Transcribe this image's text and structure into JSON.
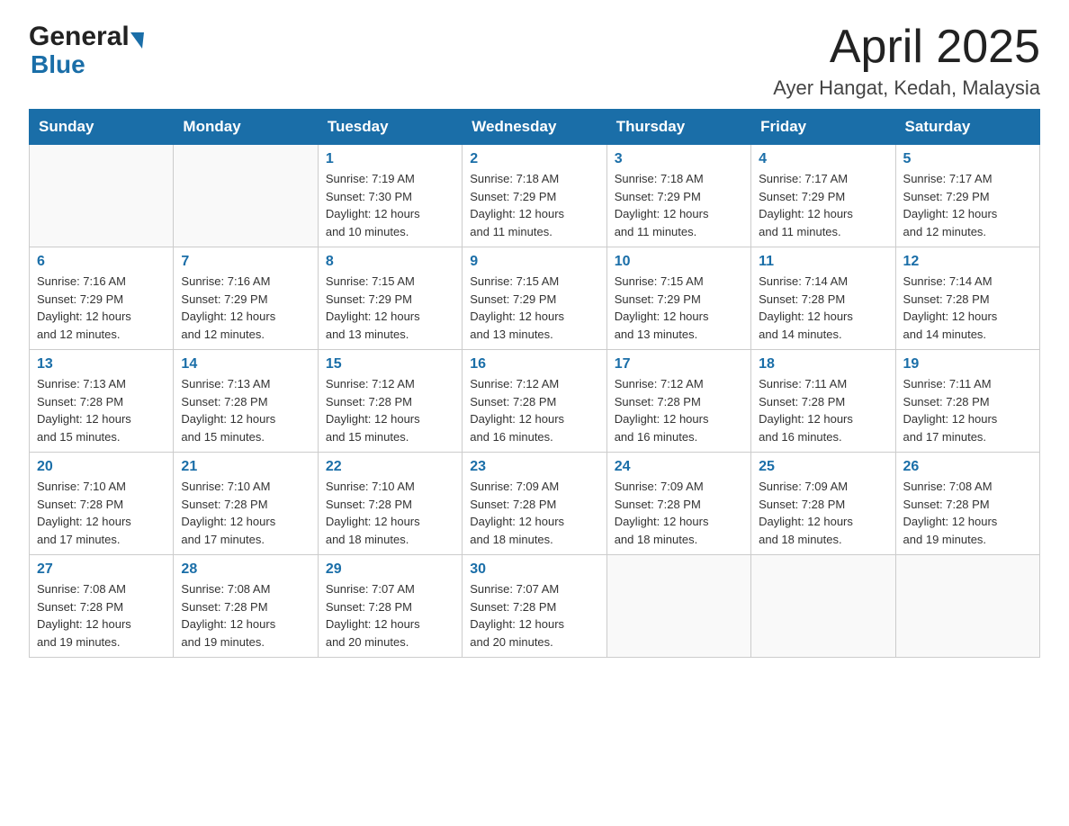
{
  "header": {
    "logo_general": "General",
    "logo_blue": "Blue",
    "title": "April 2025",
    "location": "Ayer Hangat, Kedah, Malaysia"
  },
  "weekdays": [
    "Sunday",
    "Monday",
    "Tuesday",
    "Wednesday",
    "Thursday",
    "Friday",
    "Saturday"
  ],
  "weeks": [
    [
      {
        "day": "",
        "info": ""
      },
      {
        "day": "",
        "info": ""
      },
      {
        "day": "1",
        "info": "Sunrise: 7:19 AM\nSunset: 7:30 PM\nDaylight: 12 hours\nand 10 minutes."
      },
      {
        "day": "2",
        "info": "Sunrise: 7:18 AM\nSunset: 7:29 PM\nDaylight: 12 hours\nand 11 minutes."
      },
      {
        "day": "3",
        "info": "Sunrise: 7:18 AM\nSunset: 7:29 PM\nDaylight: 12 hours\nand 11 minutes."
      },
      {
        "day": "4",
        "info": "Sunrise: 7:17 AM\nSunset: 7:29 PM\nDaylight: 12 hours\nand 11 minutes."
      },
      {
        "day": "5",
        "info": "Sunrise: 7:17 AM\nSunset: 7:29 PM\nDaylight: 12 hours\nand 12 minutes."
      }
    ],
    [
      {
        "day": "6",
        "info": "Sunrise: 7:16 AM\nSunset: 7:29 PM\nDaylight: 12 hours\nand 12 minutes."
      },
      {
        "day": "7",
        "info": "Sunrise: 7:16 AM\nSunset: 7:29 PM\nDaylight: 12 hours\nand 12 minutes."
      },
      {
        "day": "8",
        "info": "Sunrise: 7:15 AM\nSunset: 7:29 PM\nDaylight: 12 hours\nand 13 minutes."
      },
      {
        "day": "9",
        "info": "Sunrise: 7:15 AM\nSunset: 7:29 PM\nDaylight: 12 hours\nand 13 minutes."
      },
      {
        "day": "10",
        "info": "Sunrise: 7:15 AM\nSunset: 7:29 PM\nDaylight: 12 hours\nand 13 minutes."
      },
      {
        "day": "11",
        "info": "Sunrise: 7:14 AM\nSunset: 7:28 PM\nDaylight: 12 hours\nand 14 minutes."
      },
      {
        "day": "12",
        "info": "Sunrise: 7:14 AM\nSunset: 7:28 PM\nDaylight: 12 hours\nand 14 minutes."
      }
    ],
    [
      {
        "day": "13",
        "info": "Sunrise: 7:13 AM\nSunset: 7:28 PM\nDaylight: 12 hours\nand 15 minutes."
      },
      {
        "day": "14",
        "info": "Sunrise: 7:13 AM\nSunset: 7:28 PM\nDaylight: 12 hours\nand 15 minutes."
      },
      {
        "day": "15",
        "info": "Sunrise: 7:12 AM\nSunset: 7:28 PM\nDaylight: 12 hours\nand 15 minutes."
      },
      {
        "day": "16",
        "info": "Sunrise: 7:12 AM\nSunset: 7:28 PM\nDaylight: 12 hours\nand 16 minutes."
      },
      {
        "day": "17",
        "info": "Sunrise: 7:12 AM\nSunset: 7:28 PM\nDaylight: 12 hours\nand 16 minutes."
      },
      {
        "day": "18",
        "info": "Sunrise: 7:11 AM\nSunset: 7:28 PM\nDaylight: 12 hours\nand 16 minutes."
      },
      {
        "day": "19",
        "info": "Sunrise: 7:11 AM\nSunset: 7:28 PM\nDaylight: 12 hours\nand 17 minutes."
      }
    ],
    [
      {
        "day": "20",
        "info": "Sunrise: 7:10 AM\nSunset: 7:28 PM\nDaylight: 12 hours\nand 17 minutes."
      },
      {
        "day": "21",
        "info": "Sunrise: 7:10 AM\nSunset: 7:28 PM\nDaylight: 12 hours\nand 17 minutes."
      },
      {
        "day": "22",
        "info": "Sunrise: 7:10 AM\nSunset: 7:28 PM\nDaylight: 12 hours\nand 18 minutes."
      },
      {
        "day": "23",
        "info": "Sunrise: 7:09 AM\nSunset: 7:28 PM\nDaylight: 12 hours\nand 18 minutes."
      },
      {
        "day": "24",
        "info": "Sunrise: 7:09 AM\nSunset: 7:28 PM\nDaylight: 12 hours\nand 18 minutes."
      },
      {
        "day": "25",
        "info": "Sunrise: 7:09 AM\nSunset: 7:28 PM\nDaylight: 12 hours\nand 18 minutes."
      },
      {
        "day": "26",
        "info": "Sunrise: 7:08 AM\nSunset: 7:28 PM\nDaylight: 12 hours\nand 19 minutes."
      }
    ],
    [
      {
        "day": "27",
        "info": "Sunrise: 7:08 AM\nSunset: 7:28 PM\nDaylight: 12 hours\nand 19 minutes."
      },
      {
        "day": "28",
        "info": "Sunrise: 7:08 AM\nSunset: 7:28 PM\nDaylight: 12 hours\nand 19 minutes."
      },
      {
        "day": "29",
        "info": "Sunrise: 7:07 AM\nSunset: 7:28 PM\nDaylight: 12 hours\nand 20 minutes."
      },
      {
        "day": "30",
        "info": "Sunrise: 7:07 AM\nSunset: 7:28 PM\nDaylight: 12 hours\nand 20 minutes."
      },
      {
        "day": "",
        "info": ""
      },
      {
        "day": "",
        "info": ""
      },
      {
        "day": "",
        "info": ""
      }
    ]
  ]
}
